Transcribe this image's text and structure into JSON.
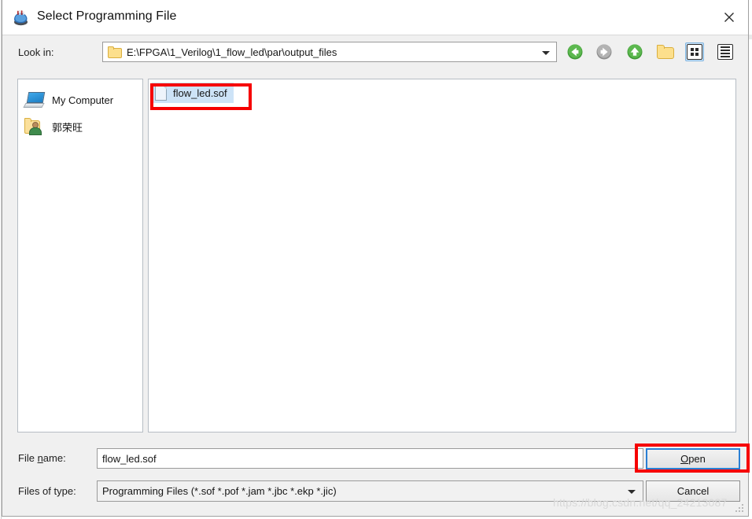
{
  "window": {
    "title": "Select Programming File",
    "title_icon": "quartus-programmer-icon",
    "close_icon": "close-icon"
  },
  "lookin": {
    "label": "Look in:",
    "path": "E:\\FPGA\\1_Verilog\\1_flow_led\\par\\output_files",
    "folder_icon": "folder-icon",
    "dropdown_icon": "chevron-down-icon"
  },
  "toolbar": {
    "back_icon": "back-arrow-icon",
    "forward_icon": "forward-arrow-icon",
    "up_icon": "up-arrow-icon",
    "new_folder_icon": "new-folder-icon",
    "list_view_icon": "list-view-icon",
    "detail_view_icon": "detail-view-icon"
  },
  "sidebar": {
    "items": [
      {
        "label": "My Computer",
        "icon": "computer-icon"
      },
      {
        "label": "郭荣旺",
        "icon": "user-folder-icon"
      }
    ]
  },
  "filelist": {
    "items": [
      {
        "name": "flow_led.sof",
        "icon": "file-icon",
        "selected": true
      }
    ]
  },
  "filename": {
    "label_prefix": "File ",
    "label_mnemonic": "n",
    "label_suffix": "ame:",
    "value": "flow_led.sof",
    "placeholder": ""
  },
  "filetype": {
    "label": "Files of type:",
    "value": "Programming Files (*.sof *.pof *.jam *.jbc *.ekp *.jic)",
    "dropdown_icon": "chevron-down-icon"
  },
  "buttons": {
    "open_mnemonic": "O",
    "open_rest": "pen",
    "cancel": "Cancel"
  },
  "annotations": {
    "color": "#f60000",
    "boxes": [
      "file-item-highlight",
      "open-button-highlight"
    ]
  },
  "watermark": {
    "text": "https://blog.csdn.net/qq_24213087"
  }
}
